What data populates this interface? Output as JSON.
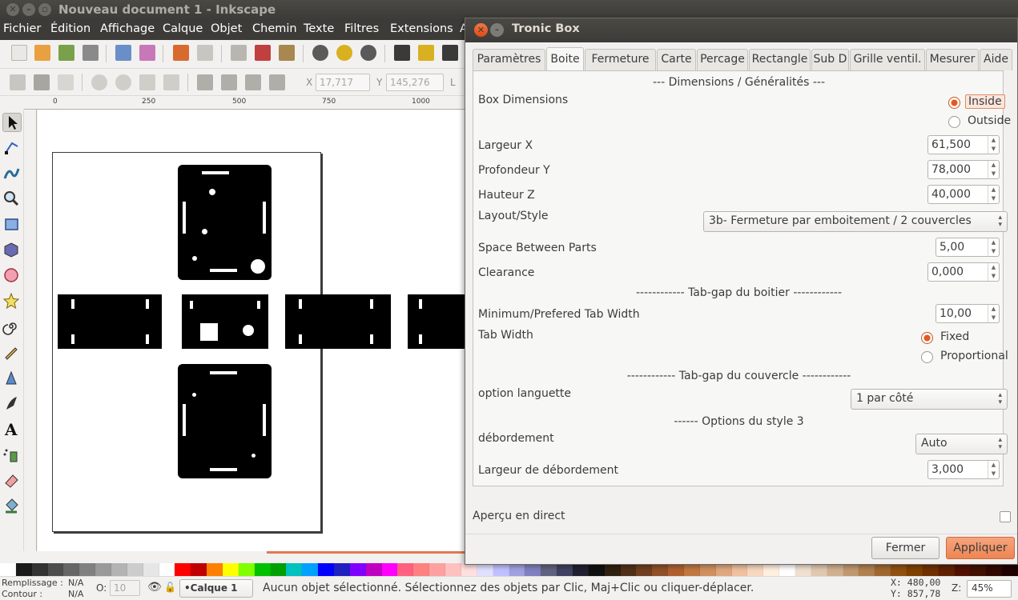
{
  "window": {
    "title": "Nouveau document 1 - Inkscape"
  },
  "menu": [
    "Fichier",
    "Édition",
    "Affichage",
    "Calque",
    "Objet",
    "Chemin",
    "Texte",
    "Filtres",
    "Extensions",
    "A"
  ],
  "toolbar": {
    "x_label": "X",
    "x_value": "17,717",
    "y_label": "Y",
    "y_value": "145,276",
    "l_label": "L"
  },
  "ruler": {
    "ticks": [
      "0",
      "250",
      "500",
      "750",
      "1000"
    ]
  },
  "colors": {
    "accent": "#e2591e",
    "titlebar": "#3c3b37",
    "canvas": "#ffffff"
  },
  "palette": [
    "#ffffff",
    "#1a1a1a",
    "#333333",
    "#4d4d4d",
    "#666666",
    "#808080",
    "#999999",
    "#b3b3b3",
    "#cccccc",
    "#e6e6e6",
    "#ffffff",
    "#ff0000",
    "#c00000",
    "#ff8000",
    "#ffff00",
    "#80ff00",
    "#00c000",
    "#00a000",
    "#00c0c0",
    "#00a0ff",
    "#0000ff",
    "#2020c0",
    "#8000ff",
    "#c000c0",
    "#ff00ff",
    "#ff6080",
    "#ff8080",
    "#ffa0a0",
    "#ffc0c0",
    "#ffe0e0",
    "#e0e0ff",
    "#c0c0ff",
    "#a0a0e0",
    "#8080c0",
    "#606080",
    "#404060",
    "#202030",
    "#101010",
    "#302010",
    "#503018",
    "#704020",
    "#905028",
    "#b06030",
    "#c07840",
    "#d09060",
    "#e0a880",
    "#f0c0a0",
    "#f8d8c0",
    "#fff0e0",
    "#ffffff",
    "#f0e0d0",
    "#e0c8b0",
    "#d0b090",
    "#c09870",
    "#b08050",
    "#a06830",
    "#905010",
    "#804000",
    "#703000",
    "#602000",
    "#501000",
    "#401000",
    "#300800",
    "#200000"
  ],
  "status": {
    "fill_label": "Remplissage :",
    "fill_value": "N/A",
    "stroke_label": "Contour :",
    "stroke_value": "N/A",
    "opacity_label": "O:",
    "opacity_value": "10",
    "layer": "•Calque 1",
    "message": "Aucun objet sélectionné. Sélectionnez des objets par Clic, Maj+Clic ou cliquer-déplacer.",
    "x_readout": "X:  480,00",
    "y_readout": "Y:  857,78",
    "zoom_label": "Z:",
    "zoom_value": "45%"
  },
  "dialog": {
    "title": "Tronic Box",
    "tabs": [
      "Paramètres",
      "Boite",
      "Fermeture",
      "Carte",
      "Percage",
      "Rectangle",
      "Sub D",
      "Grille ventil.",
      "Mesurer",
      "Aide"
    ],
    "active_tab": "Boite",
    "section_dims": "--- Dimensions / Généralités ---",
    "box_dimensions_label": "Box Dimensions",
    "radio_inside": "Inside",
    "radio_outside": "Outside",
    "largeur_label": "Largeur X",
    "largeur_value": "61,500",
    "profondeur_label": "Profondeur Y",
    "profondeur_value": "78,000",
    "hauteur_label": "Hauteur Z",
    "hauteur_value": "40,000",
    "layout_label": "Layout/Style",
    "layout_value": "3b- Fermeture par emboitement / 2 couvercles",
    "space_label": "Space Between Parts",
    "space_value": "5,00",
    "clearance_label": "Clearance",
    "clearance_value": "0,000",
    "section_tabgap_box": "------------ Tab-gap du boitier ------------",
    "min_tab_label": "Minimum/Prefered Tab Width",
    "min_tab_value": "10,00",
    "tab_width_label": "Tab Width",
    "radio_fixed": "Fixed",
    "radio_proportional": "Proportional",
    "section_tabgap_lid": "------------ Tab-gap du couvercle ------------",
    "option_languette_label": "option languette",
    "option_languette_value": "1 par côté",
    "section_style3": "------ Options du style 3",
    "debordement_label": "débordement",
    "debordement_value": "Auto",
    "largeur_deb_label": "Largeur de débordement",
    "largeur_deb_value": "3,000",
    "preview_label": "Aperçu en direct",
    "cancel_button": "Fermer",
    "apply_button": "Appliquer"
  }
}
